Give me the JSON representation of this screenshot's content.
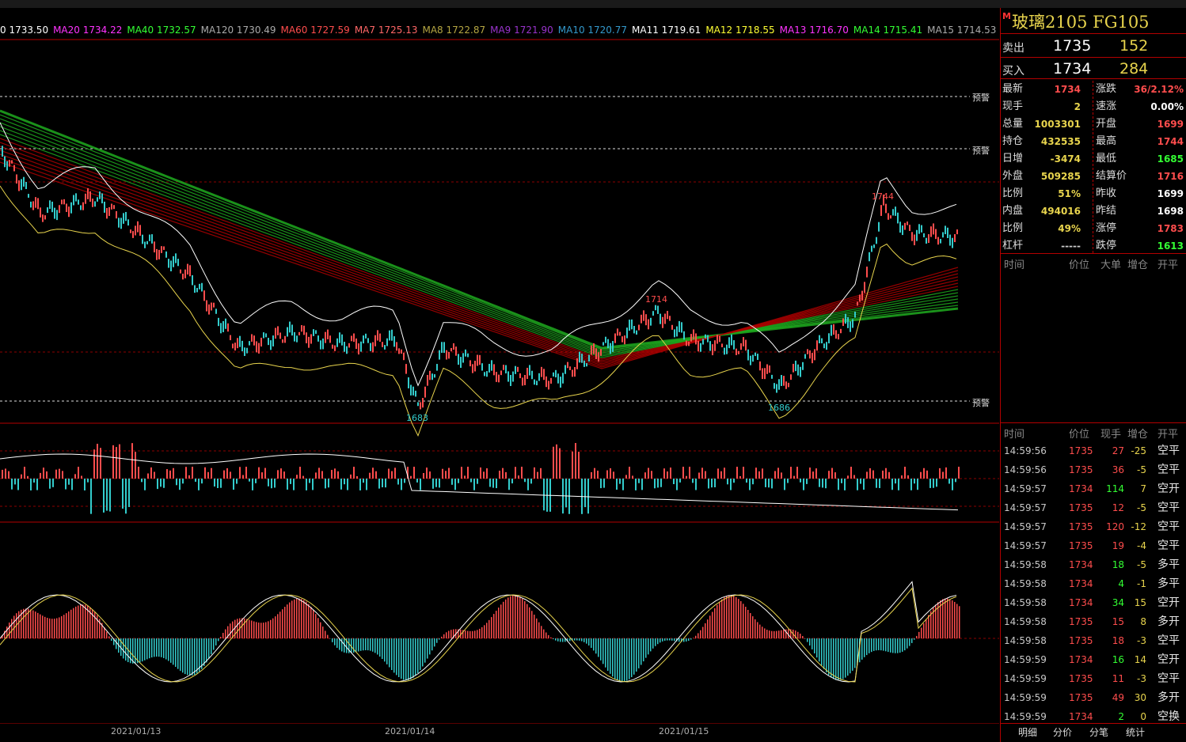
{
  "ma_legend": [
    {
      "text": "0 1733.50",
      "color": "#ffffff"
    },
    {
      "text": "MA20 1734.22",
      "color": "#ff33ff"
    },
    {
      "text": "MA40 1732.57",
      "color": "#33ff33"
    },
    {
      "text": "MA120 1730.49",
      "color": "#aaaaaa"
    },
    {
      "text": "MA60 1727.59",
      "color": "#ff4d4d"
    },
    {
      "text": "MA7 1725.13",
      "color": "#ff6666"
    },
    {
      "text": "MA8 1722.87",
      "color": "#b5a642"
    },
    {
      "text": "MA9 1721.90",
      "color": "#9933cc"
    },
    {
      "text": "MA10 1720.77",
      "color": "#3399cc"
    },
    {
      "text": "MA11 1719.61",
      "color": "#ffffff"
    },
    {
      "text": "MA12 1718.55",
      "color": "#ffff33"
    },
    {
      "text": "MA13 1716.70",
      "color": "#ff33ff"
    },
    {
      "text": "MA14 1715.41",
      "color": "#33ff33"
    },
    {
      "text": "MA15 1714.53",
      "color": "#aaaaaa"
    }
  ],
  "chart": {
    "warn_label": "预警",
    "high_1": "1714",
    "high_2": "1744",
    "low_1": "1683",
    "low_2": "1686",
    "dates": [
      "2021/01/13",
      "2021/01/14",
      "2021/01/15"
    ]
  },
  "panel": {
    "badge": "M",
    "title": "玻璃2105  FG105",
    "sell_label": "卖出",
    "sell_price": "1735",
    "sell_vol": "152",
    "buy_label": "买入",
    "buy_price": "1734",
    "buy_vol": "284",
    "stats_left": [
      {
        "label": "最新",
        "value": "1734",
        "color": "#ff4d4d"
      },
      {
        "label": "现手",
        "value": "2",
        "color": "#e8d44d"
      },
      {
        "label": "总量",
        "value": "1003301",
        "color": "#e8d44d"
      },
      {
        "label": "持仓",
        "value": "432535",
        "color": "#e8d44d"
      },
      {
        "label": "日增",
        "value": "-3474",
        "color": "#e8d44d"
      },
      {
        "label": "外盘",
        "value": "509285",
        "color": "#e8d44d"
      },
      {
        "label": "比例",
        "value": "51%",
        "color": "#e8d44d"
      },
      {
        "label": "内盘",
        "value": "494016",
        "color": "#e8d44d"
      },
      {
        "label": "比例",
        "value": "49%",
        "color": "#e8d44d"
      },
      {
        "label": "杠杆",
        "value": "-----",
        "color": "#cccccc"
      }
    ],
    "stats_right": [
      {
        "label": "涨跌",
        "value": "36/2.12%",
        "color": "#ff4d4d"
      },
      {
        "label": "速涨",
        "value": "0.00%",
        "color": "#ffffff"
      },
      {
        "label": "开盘",
        "value": "1699",
        "color": "#ff4d4d"
      },
      {
        "label": "最高",
        "value": "1744",
        "color": "#ff4d4d"
      },
      {
        "label": "最低",
        "value": "1685",
        "color": "#33ff33"
      },
      {
        "label": "结算价",
        "value": "1716",
        "color": "#ff4d4d"
      },
      {
        "label": "昨收",
        "value": "1699",
        "color": "#ffffff"
      },
      {
        "label": "昨结",
        "value": "1698",
        "color": "#ffffff"
      },
      {
        "label": "涨停",
        "value": "1783",
        "color": "#ff4d4d"
      },
      {
        "label": "跌停",
        "value": "1613",
        "color": "#33ff33"
      }
    ],
    "big_header": {
      "time": "时间",
      "price": "价位",
      "big": "大单",
      "oi": "增仓",
      "type": "开平"
    },
    "tick_header": {
      "time": "时间",
      "price": "价位",
      "vol": "现手",
      "oi": "增仓",
      "type": "开平"
    },
    "ticks": [
      {
        "time": "14:59:56",
        "price": "1735",
        "vol": "27",
        "oi": "-25",
        "type": "空平",
        "vc": "#ff4d4d"
      },
      {
        "time": "14:59:56",
        "price": "1735",
        "vol": "36",
        "oi": "-5",
        "type": "空平",
        "vc": "#ff4d4d"
      },
      {
        "time": "14:59:57",
        "price": "1734",
        "vol": "114",
        "oi": "7",
        "type": "空开",
        "vc": "#33ff33"
      },
      {
        "time": "14:59:57",
        "price": "1735",
        "vol": "12",
        "oi": "-5",
        "type": "空平",
        "vc": "#ff4d4d"
      },
      {
        "time": "14:59:57",
        "price": "1735",
        "vol": "120",
        "oi": "-12",
        "type": "空平",
        "vc": "#ff4d4d"
      },
      {
        "time": "14:59:57",
        "price": "1735",
        "vol": "19",
        "oi": "-4",
        "type": "空平",
        "vc": "#ff4d4d"
      },
      {
        "time": "14:59:58",
        "price": "1734",
        "vol": "18",
        "oi": "-5",
        "type": "多平",
        "vc": "#33ff33"
      },
      {
        "time": "14:59:58",
        "price": "1734",
        "vol": "4",
        "oi": "-1",
        "type": "多平",
        "vc": "#33ff33"
      },
      {
        "time": "14:59:58",
        "price": "1734",
        "vol": "34",
        "oi": "15",
        "type": "空开",
        "vc": "#33ff33"
      },
      {
        "time": "14:59:58",
        "price": "1735",
        "vol": "15",
        "oi": "8",
        "type": "多开",
        "vc": "#ff4d4d"
      },
      {
        "time": "14:59:58",
        "price": "1735",
        "vol": "18",
        "oi": "-3",
        "type": "空平",
        "vc": "#ff4d4d"
      },
      {
        "time": "14:59:59",
        "price": "1734",
        "vol": "16",
        "oi": "14",
        "type": "空开",
        "vc": "#33ff33"
      },
      {
        "time": "14:59:59",
        "price": "1735",
        "vol": "11",
        "oi": "-3",
        "type": "空平",
        "vc": "#ff4d4d"
      },
      {
        "time": "14:59:59",
        "price": "1735",
        "vol": "49",
        "oi": "30",
        "type": "多开",
        "vc": "#ff4d4d"
      },
      {
        "time": "14:59:59",
        "price": "1734",
        "vol": "2",
        "oi": "0",
        "type": "空换",
        "vc": "#33ff33"
      }
    ],
    "tabs": [
      "明细",
      "分价",
      "分笔",
      "统计"
    ]
  }
}
